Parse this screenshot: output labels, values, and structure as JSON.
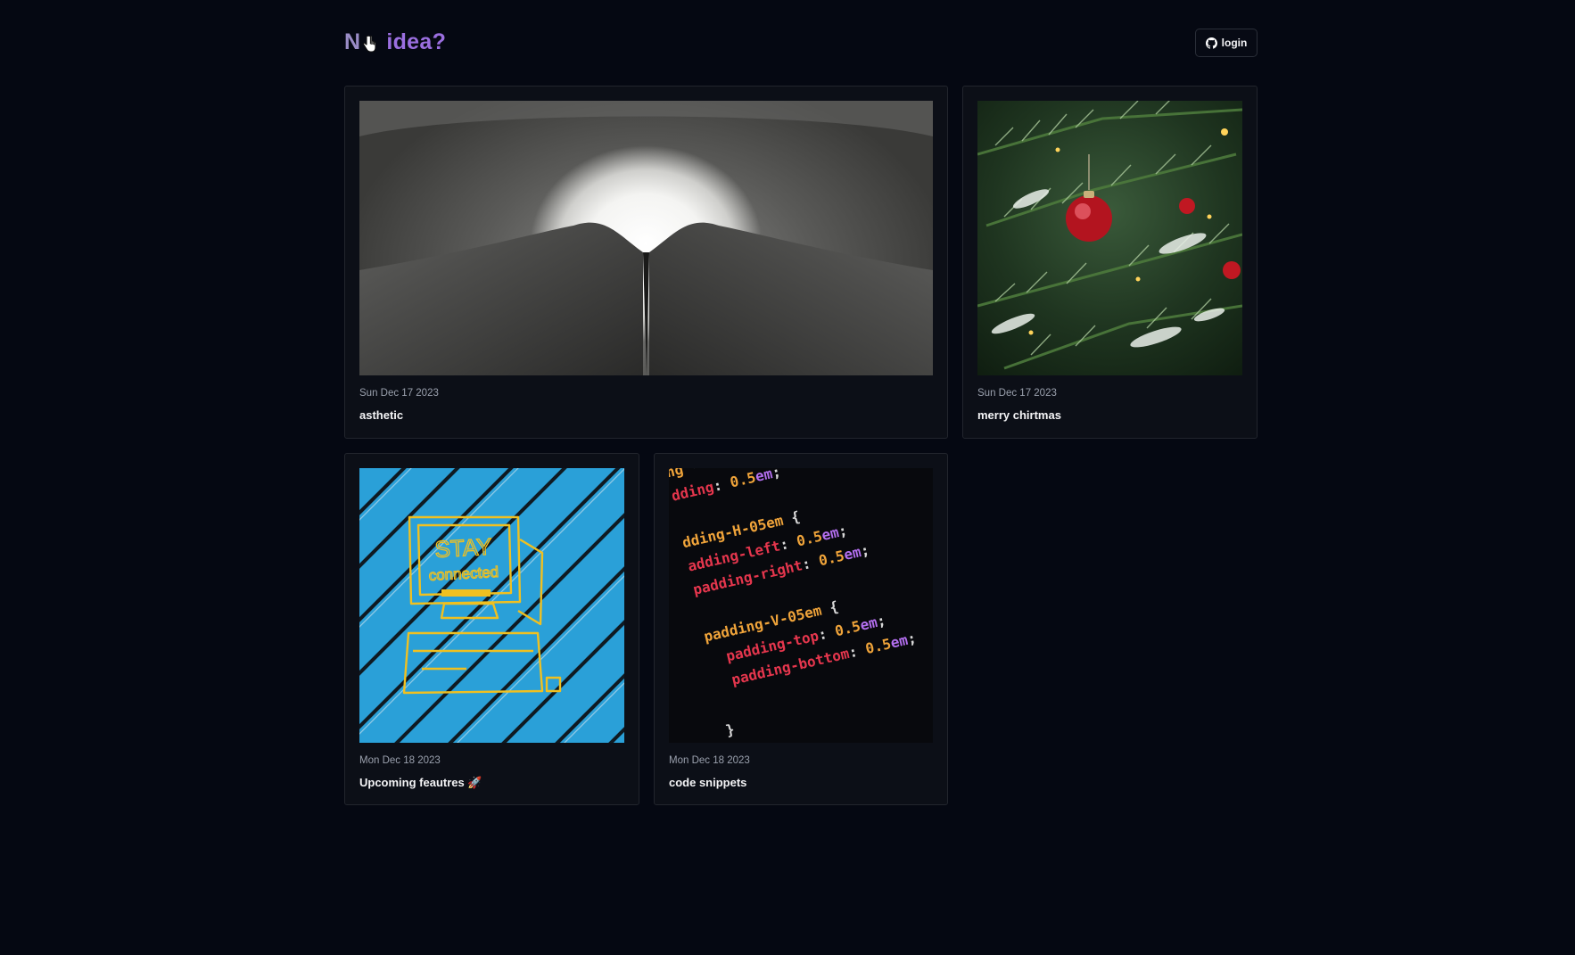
{
  "header": {
    "logo_prefix": "N",
    "logo_suffix": "idea?",
    "login_label": "login"
  },
  "colors": {
    "background": "#050812",
    "accent": "#9b6fe0",
    "card_border": "#22252d"
  },
  "posts": [
    {
      "date": "Sun Dec 17 2023",
      "title": "asthetic",
      "image": "tunnel-light"
    },
    {
      "date": "Sun Dec 17 2023",
      "title": "merry chirtmas",
      "image": "christmas-tree-ornament"
    },
    {
      "date": "Mon Dec 18 2023",
      "title": "Upcoming feautres 🚀",
      "image": "stay-connected-computer-drawing"
    },
    {
      "date": "Mon Dec 18 2023",
      "title": "code snippets",
      "image": "css-code-closeup"
    }
  ]
}
